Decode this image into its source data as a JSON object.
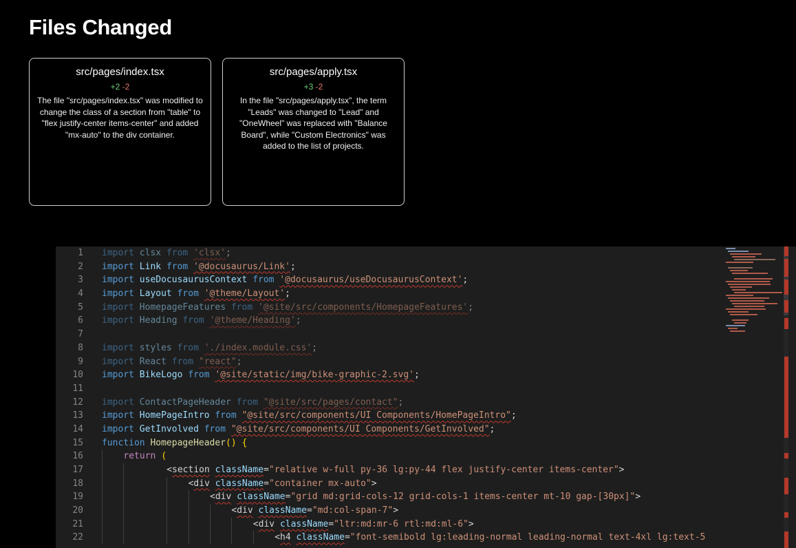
{
  "page": {
    "title": "Files Changed"
  },
  "files": [
    {
      "path": "src/pages/index.tsx",
      "additions": "+2",
      "deletions": "-2",
      "description": "The file \"src/pages/index.tsx\" was modified to change the class of a section from \"table\" to \"flex justify-center items-center\" and added \"mx-auto\" to the div container."
    },
    {
      "path": "src/pages/apply.tsx",
      "additions": "+3",
      "deletions": "-2",
      "description": "In the file \"src/pages/apply.tsx\", the term \"Leads\" was changed to \"Lead\" and \"OneWheel\" was replaced with \"Balance Board\", while \"Custom Electronics\" was added to the list of projects."
    }
  ],
  "editor": {
    "line_numbers": [
      "1",
      "2",
      "3",
      "4",
      "5",
      "6",
      "7",
      "8",
      "9",
      "10",
      "11",
      "12",
      "13",
      "14",
      "15",
      "16",
      "17",
      "18",
      "19",
      "20",
      "21",
      "22"
    ],
    "lines": [
      {
        "kw": "import",
        "name": "clsx",
        "from": "from",
        "src": "'clsx'",
        "end": ";"
      },
      {
        "kw": "import",
        "name": "Link",
        "from": "from",
        "src": "'@docusaurus/Link'",
        "end": ";"
      },
      {
        "kw": "import",
        "name": "useDocusaurusContext",
        "from": "from",
        "src": "'@docusaurus/useDocusaurusContext'",
        "end": ";"
      },
      {
        "kw": "import",
        "name": "Layout",
        "from": "from",
        "src": "'@theme/Layout'",
        "end": ";"
      },
      {
        "kw": "import",
        "name": "HomepageFeatures",
        "from": "from",
        "src": "'@site/src/components/HomepageFeatures'",
        "end": ";"
      },
      {
        "kw": "import",
        "name": "Heading",
        "from": "from",
        "src": "'@theme/Heading'",
        "end": ";"
      },
      {},
      {
        "kw": "import",
        "name": "styles",
        "from": "from",
        "src": "'./index.module.css'",
        "end": ";"
      },
      {
        "kw": "import",
        "name": "React",
        "from": "from",
        "src": "\"react\"",
        "end": ";"
      },
      {
        "kw": "import",
        "name": "BikeLogo",
        "from": "from",
        "src": "'@site/static/img/bike-graphic-2.svg'",
        "end": ";"
      },
      {},
      {
        "kw": "import",
        "name": "ContactPageHeader",
        "from": "from",
        "src": "\"@site/src/pages/contact\"",
        "end": ";"
      },
      {
        "kw": "import",
        "name": "HomePageIntro",
        "from": "from",
        "src": "\"@site/src/components/UI Components/HomePageIntro\"",
        "end": ";"
      },
      {
        "kw": "import",
        "name": "GetInvolved",
        "from": "from",
        "src": "\"@site/src/components/UI Components/GetInvolved\"",
        "end": ";"
      },
      {
        "kw": "function",
        "name": "HomepageHeader",
        "paren": "()",
        "brace": "{"
      },
      {
        "kw": "return",
        "paren": "("
      },
      {
        "tag": "section",
        "attr": "className",
        "eq": "=",
        "val": "\"relative w-full py-36 lg:py-44 flex justify-center items-center\"",
        "close": ">",
        "lt": "<"
      },
      {
        "tag": "div",
        "attr": "className",
        "eq": "=",
        "val": "\"container mx-auto\"",
        "close": ">",
        "lt": "<"
      },
      {
        "tag": "div",
        "attr": "className",
        "eq": "=",
        "val": "\"grid md:grid-cols-12 grid-cols-1 items-center mt-10 gap-[30px]\"",
        "close": ">",
        "lt": "<"
      },
      {
        "tag": "div",
        "attr": "className",
        "eq": "=",
        "val": "\"md:col-span-7\"",
        "close": ">",
        "lt": "<"
      },
      {
        "tag": "div",
        "attr": "className",
        "eq": "=",
        "val": "\"ltr:md:mr-6 rtl:md:ml-6\"",
        "close": ">",
        "lt": "<"
      },
      {
        "tag": "h4",
        "attr": "className",
        "eq": "=",
        "val": "\"font-semibold lg:leading-normal leading-normal text-4xl lg:text-5",
        "close": "",
        "lt": "<"
      }
    ]
  },
  "colors": {
    "background": "#000000",
    "editor_bg": "#1e1e1e",
    "accent_add": "#6fd27a",
    "accent_del": "#e87b6f",
    "error_mark": "#b3392b"
  }
}
